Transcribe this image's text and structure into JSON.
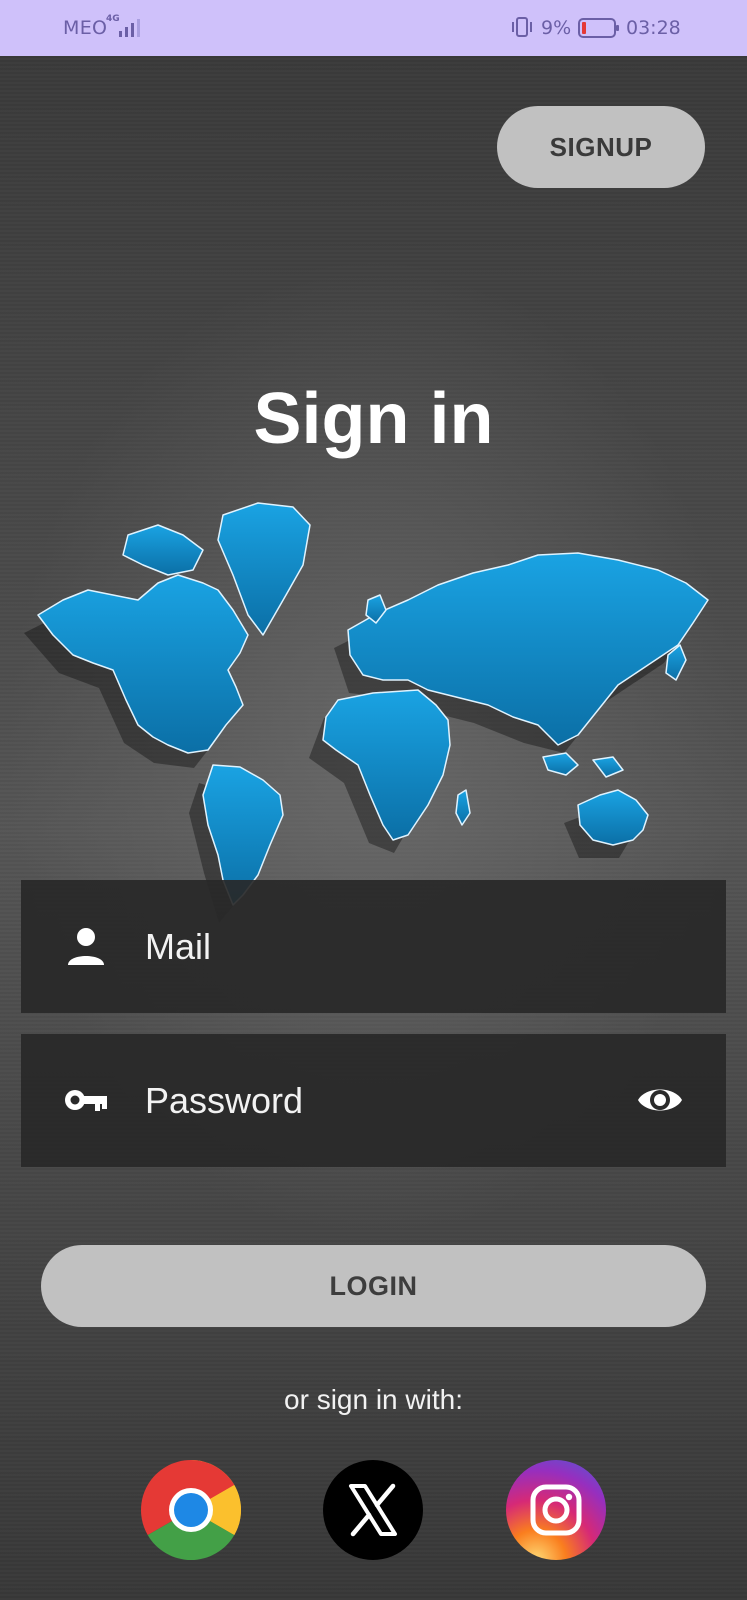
{
  "status_bar": {
    "carrier": "MEO",
    "network": "4G",
    "battery_percent": "9%",
    "time": "03:28",
    "icons": [
      "signal-icon",
      "vibrate-icon",
      "battery-low-icon"
    ],
    "color": "#cfc1fa"
  },
  "header": {
    "signup_label": "SIGNUP"
  },
  "main": {
    "title": "Sign in",
    "illustration": "world-map-icon",
    "mail_field": {
      "placeholder": "Mail",
      "icon": "user-icon"
    },
    "password_field": {
      "placeholder": "Password",
      "icon": "key-icon",
      "toggle_icon": "eye-icon"
    },
    "login_label": "LOGIN",
    "alt_signin_label": "or sign in with:",
    "social_buttons": [
      {
        "name": "chrome",
        "icon": "chrome-icon"
      },
      {
        "name": "x",
        "icon": "x-logo-icon"
      },
      {
        "name": "instagram",
        "icon": "instagram-icon"
      }
    ]
  },
  "colors": {
    "background": "#3c3c3c",
    "button": "#c1c1c1",
    "field": "#282828",
    "map_blue": "#1597d6"
  }
}
